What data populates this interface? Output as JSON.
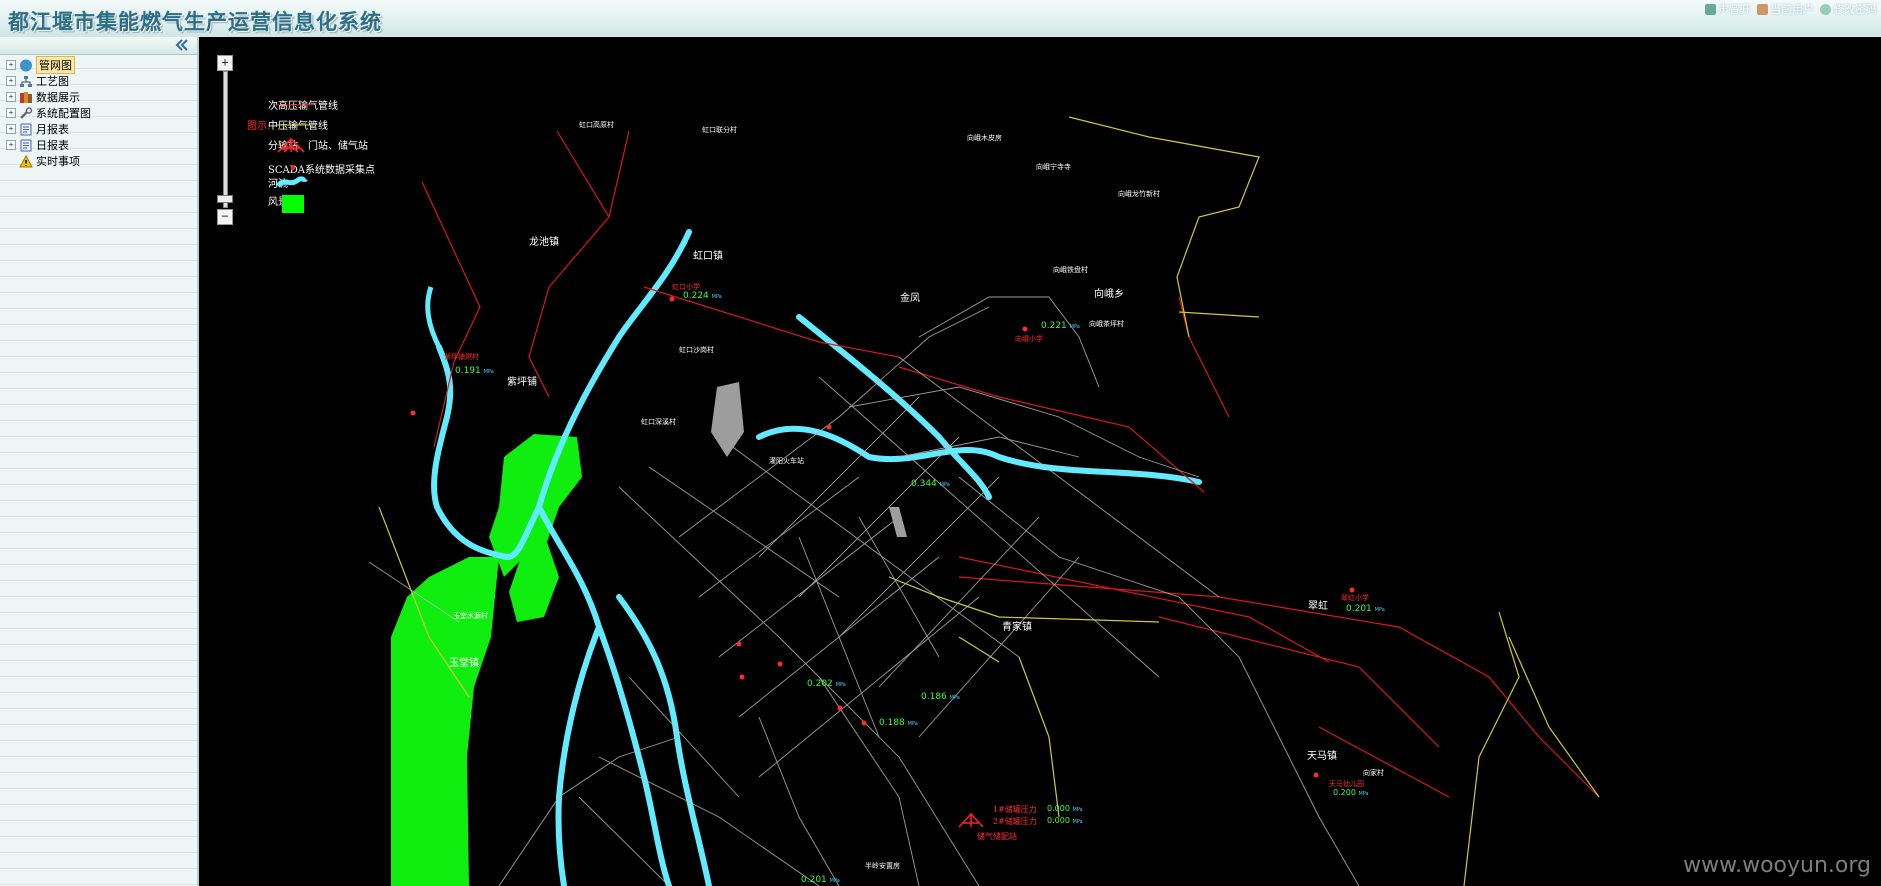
{
  "header": {
    "title": "都江堰市集能燃气生产运营信息化系统",
    "links": [
      {
        "label": "声音开",
        "icon": "speaker-icon"
      },
      {
        "label": "当前用户",
        "icon": "user-icon"
      },
      {
        "label": "修改密码",
        "icon": "key-icon"
      }
    ]
  },
  "sidebar": {
    "items": [
      {
        "label": "管网图",
        "icon": "globe-icon",
        "expandable": true,
        "selected": true
      },
      {
        "label": "工艺图",
        "icon": "process-icon",
        "expandable": true
      },
      {
        "label": "数据展示",
        "icon": "books-icon",
        "expandable": true
      },
      {
        "label": "系统配置图",
        "icon": "wrench-icon",
        "expandable": true
      },
      {
        "label": "月报表",
        "icon": "report-icon",
        "expandable": true
      },
      {
        "label": "日报表",
        "icon": "report-icon",
        "expandable": true
      },
      {
        "label": "实时事项",
        "icon": "warning-icon",
        "expandable": false
      }
    ]
  },
  "legend": {
    "title": "图示:",
    "items": [
      {
        "label": "次高压输气管线",
        "symbol": "red-line",
        "color": "#d01010"
      },
      {
        "label": "中压输气管线",
        "symbol": "yellow-line",
        "color": "#d8d040"
      },
      {
        "label": "分输站、门站、储气站",
        "symbol": "station-icon",
        "color": "#ff2020"
      },
      {
        "label": "SCADA系统数据采集点",
        "symbol": "scada-dot-icon",
        "color": "#ff2020"
      },
      {
        "label": "河流",
        "symbol": "river-icon",
        "color": "#5ff0ff"
      },
      {
        "label": "风景区",
        "symbol": "scenic-area-icon",
        "color": "#00ff00"
      }
    ]
  },
  "map": {
    "place_labels": [
      {
        "text": "龙池镇"
      },
      {
        "text": "紫坪铺"
      },
      {
        "text": "虹口镇"
      },
      {
        "text": "金凤"
      },
      {
        "text": "向峨乡"
      },
      {
        "text": "青家镇"
      },
      {
        "text": "翠虹"
      },
      {
        "text": "天马镇"
      },
      {
        "text": "玉堂镇"
      },
      {
        "text": "虹口高原村"
      },
      {
        "text": "虹口联分村"
      },
      {
        "text": "虹口沙岗村"
      },
      {
        "text": "虹口深溪村"
      },
      {
        "text": "玉堂水源村"
      },
      {
        "text": "灌阳火车站"
      },
      {
        "text": "向峨木皮房"
      },
      {
        "text": "向峨宁寺寺"
      },
      {
        "text": "向峨龙竹新村"
      },
      {
        "text": "向峨铁盘村"
      },
      {
        "text": "向峨茶坪村"
      },
      {
        "text": "向家村"
      },
      {
        "text": "半岭安置房"
      }
    ],
    "readings": [
      {
        "value": "0.224",
        "unit": "MPa"
      },
      {
        "value": "0.191",
        "unit": "MPa"
      },
      {
        "value": "0.221",
        "unit": "MPa"
      },
      {
        "value": "0.201",
        "unit": "MPa"
      },
      {
        "value": "0.202",
        "unit": "MPa"
      },
      {
        "value": "0.186",
        "unit": "MPa"
      },
      {
        "value": "0.188",
        "unit": "MPa"
      },
      {
        "value": "0.344",
        "unit": "MPa"
      },
      {
        "value": "0.200",
        "unit": "MPa"
      },
      {
        "value": "0.201",
        "unit": "MPa"
      },
      {
        "value": "0.000",
        "unit": "MPa"
      },
      {
        "value": "0.000",
        "unit": "MPa"
      }
    ],
    "station_labels": [
      {
        "text": "紫坪铺燃村"
      },
      {
        "text": "虹口小学"
      },
      {
        "text": "向峨小学"
      },
      {
        "text": "翠虹小学"
      },
      {
        "text": "天马幼儿园"
      },
      {
        "text": "1#储罐压力"
      },
      {
        "text": "2#储罐压力"
      },
      {
        "text": "储气储配站"
      }
    ]
  },
  "watermark": "www.wooyun.org"
}
